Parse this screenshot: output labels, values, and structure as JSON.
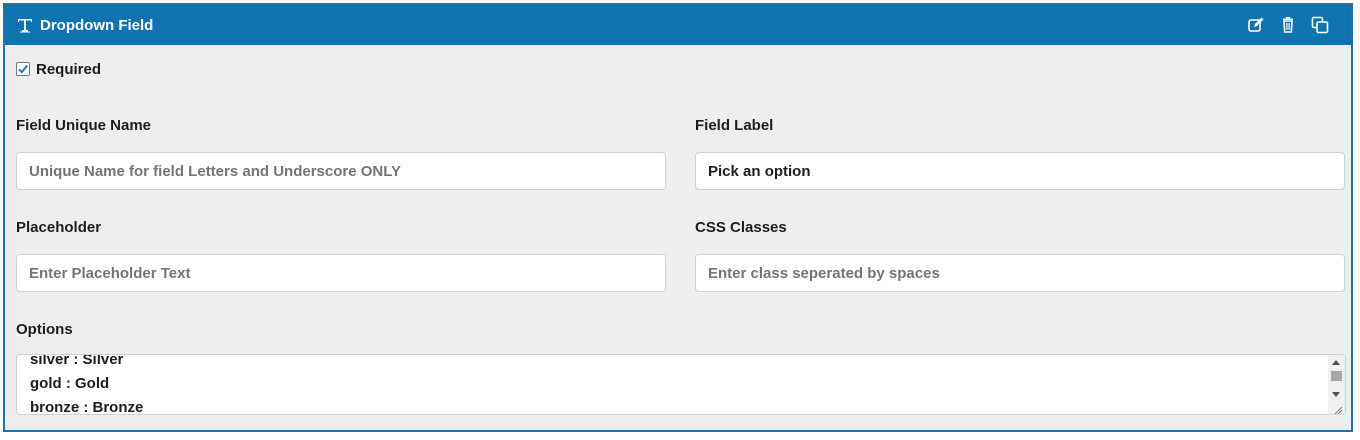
{
  "header": {
    "title": "Dropdown Field",
    "title_icon": "text-t-icon",
    "actions": [
      {
        "name": "edit-icon"
      },
      {
        "name": "trash-icon"
      },
      {
        "name": "copy-icon"
      }
    ]
  },
  "required": {
    "label": "Required",
    "checked": true
  },
  "fields": {
    "unique_name": {
      "label": "Field Unique Name",
      "value": "",
      "placeholder": "Unique Name for field Letters and Underscore ONLY"
    },
    "field_label": {
      "label": "Field Label",
      "value": "Pick an option",
      "placeholder": ""
    },
    "placeholder": {
      "label": "Placeholder",
      "value": "",
      "placeholder": "Enter Placeholder Text"
    },
    "css_classes": {
      "label": "CSS Classes",
      "value": "",
      "placeholder": "Enter class seperated by spaces"
    }
  },
  "options": {
    "label": "Options",
    "lines": [
      "silver : Silver",
      "gold : Gold",
      "bronze : Bronze"
    ]
  },
  "colors": {
    "header_bg": "#0f73b0",
    "panel_bg": "#eeeeee",
    "checkbox_check": "#1f73c8"
  }
}
